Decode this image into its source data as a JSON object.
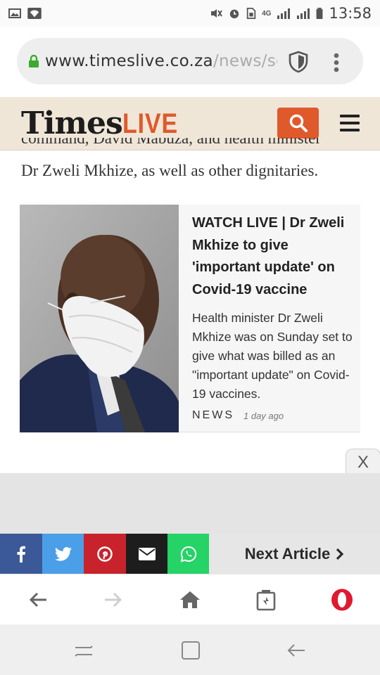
{
  "status_bar": {
    "time": "13:58",
    "network": "4G",
    "icons": [
      "image-icon",
      "wifi-icon",
      "mute-icon",
      "alarm-icon",
      "sim-icon",
      "signal-icon",
      "signal-icon",
      "battery-icon"
    ]
  },
  "browser": {
    "url_host": "www.timeslive.co.za",
    "url_path": "/news/sc",
    "icons": [
      "lock-icon",
      "shield-icon",
      "more-vert-icon"
    ]
  },
  "site_header": {
    "logo_times": "Times",
    "logo_live": "LIVE",
    "accent_color": "#e0592a",
    "header_bg": "#efe6d8"
  },
  "article": {
    "cut_line": "command, David Mabuza, and health minister",
    "body_line": "Dr Zweli Mkhize, as well as other dignitaries."
  },
  "card": {
    "title": "WATCH LIVE | Dr Zweli Mkhize to give 'important update' on Covid-19 vaccine",
    "description": "Health minister Dr Zweli Mkhize was on Sunday set to give what was billed as an \"important update\" on Covid-19 vaccines.",
    "category": "NEWS",
    "time_ago": "1 day ago"
  },
  "ad": {
    "close_label": "X"
  },
  "share_bar": {
    "buttons": [
      {
        "name": "facebook-icon",
        "color": "#3b5998"
      },
      {
        "name": "twitter-icon",
        "color": "#4a9fe8"
      },
      {
        "name": "pinterest-icon",
        "color": "#c8232c"
      },
      {
        "name": "email-icon",
        "color": "#1d1d1d"
      },
      {
        "name": "whatsapp-icon",
        "color": "#25d366"
      }
    ],
    "next_label": "Next Article"
  },
  "browser_nav": {
    "icons": [
      "back-arrow-icon",
      "forward-arrow-icon",
      "home-icon",
      "tabs-icon",
      "opera-icon"
    ]
  },
  "android_nav": {
    "icons": [
      "recents-icon",
      "home-square-icon",
      "back-icon"
    ]
  }
}
